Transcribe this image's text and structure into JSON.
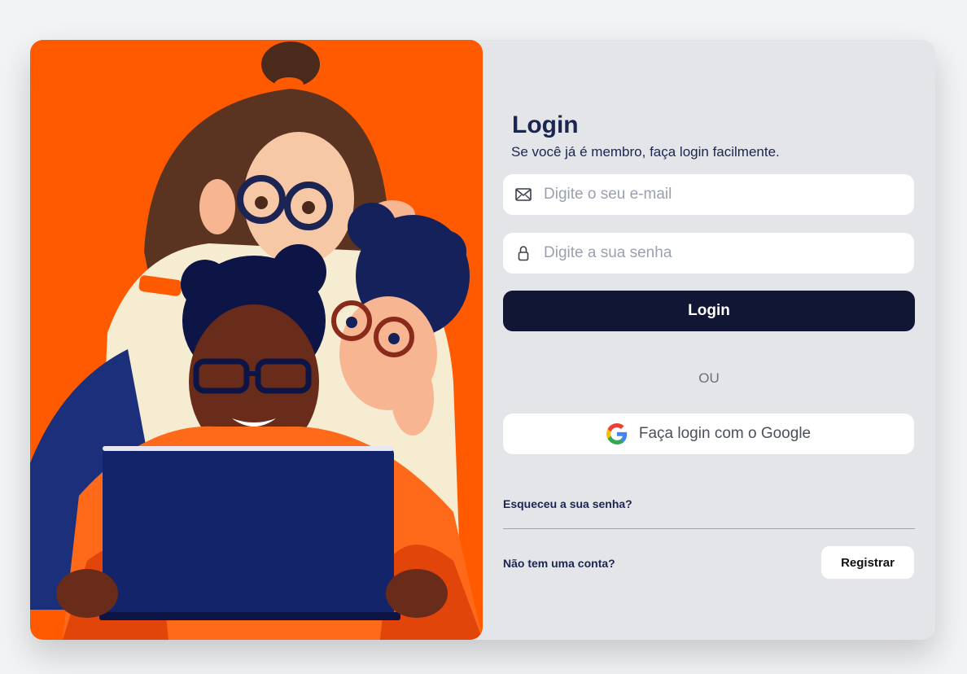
{
  "login": {
    "title": "Login",
    "subtitle": "Se você já é membro, faça login facilmente.",
    "email_placeholder": "Digite o seu e-mail",
    "password_placeholder": "Digite a sua senha",
    "submit_label": "Login",
    "divider_text": "OU",
    "google_label": "Faça login com o Google",
    "forgot_label": "Esqueceu a sua senha?",
    "no_account_label": "Não tem uma conta?",
    "register_label": "Registrar"
  },
  "icons": {
    "email": "envelope-icon",
    "password": "lock-icon",
    "google": "google-logo-icon"
  },
  "colors": {
    "hero_background": "#ff5a00",
    "primary_button": "#111634",
    "title_text": "#1a2550",
    "panel_background": "#e4e5e9"
  }
}
